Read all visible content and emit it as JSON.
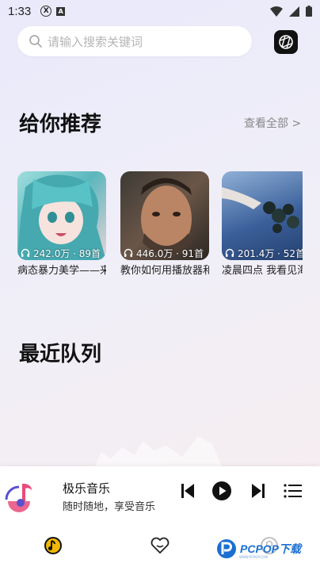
{
  "status_bar": {
    "time": "1:33",
    "icon_x": "X",
    "icon_a": "A"
  },
  "search": {
    "placeholder": "请输入搜索关键词"
  },
  "recommend": {
    "title": "给你推荐",
    "view_all": "查看全部 >",
    "cards": [
      {
        "stat": "242.0万 · 89首",
        "name": "病态暴力美学——来自于邪恶的艺术",
        "bg": "#7ac7c9"
      },
      {
        "stat": "446.0万 · 91首",
        "name": "教你如何用播放器和室友断绝关系",
        "bg": "#6a5648"
      },
      {
        "stat": "201.4万 · 52首",
        "name": "凌晨四点 我看见海棠花未眠",
        "bg": "#3b5f9a"
      }
    ]
  },
  "queue": {
    "title": "最近队列"
  },
  "player": {
    "title": "极乐音乐",
    "subtitle": "随时随地，享受音乐"
  },
  "watermark": {
    "text": "PCPOP下载",
    "sub": "WWW.PCPOP.COM"
  },
  "colors": {
    "accent": "#f2b705",
    "logo_pink": "#e84b7a",
    "logo_purple": "#5a4fcf"
  }
}
